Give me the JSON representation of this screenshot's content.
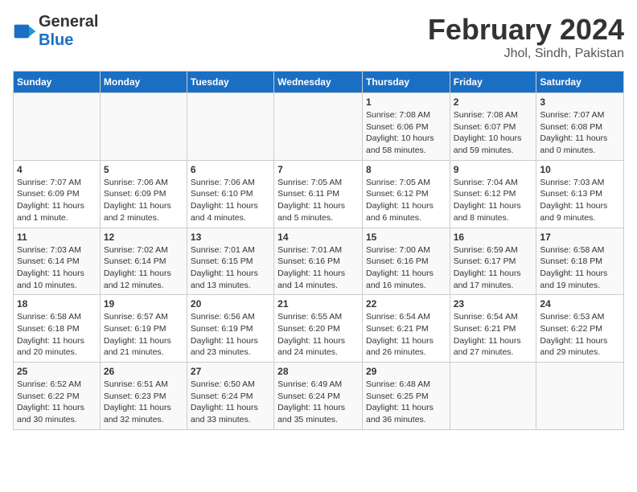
{
  "header": {
    "logo_line1": "General",
    "logo_line2": "Blue",
    "title": "February 2024",
    "subtitle": "Jhol, Sindh, Pakistan"
  },
  "calendar": {
    "days_of_week": [
      "Sunday",
      "Monday",
      "Tuesday",
      "Wednesday",
      "Thursday",
      "Friday",
      "Saturday"
    ],
    "weeks": [
      [
        {
          "day": "",
          "info": ""
        },
        {
          "day": "",
          "info": ""
        },
        {
          "day": "",
          "info": ""
        },
        {
          "day": "",
          "info": ""
        },
        {
          "day": "1",
          "info": "Sunrise: 7:08 AM\nSunset: 6:06 PM\nDaylight: 10 hours and 58 minutes."
        },
        {
          "day": "2",
          "info": "Sunrise: 7:08 AM\nSunset: 6:07 PM\nDaylight: 10 hours and 59 minutes."
        },
        {
          "day": "3",
          "info": "Sunrise: 7:07 AM\nSunset: 6:08 PM\nDaylight: 11 hours and 0 minutes."
        }
      ],
      [
        {
          "day": "4",
          "info": "Sunrise: 7:07 AM\nSunset: 6:09 PM\nDaylight: 11 hours and 1 minute."
        },
        {
          "day": "5",
          "info": "Sunrise: 7:06 AM\nSunset: 6:09 PM\nDaylight: 11 hours and 2 minutes."
        },
        {
          "day": "6",
          "info": "Sunrise: 7:06 AM\nSunset: 6:10 PM\nDaylight: 11 hours and 4 minutes."
        },
        {
          "day": "7",
          "info": "Sunrise: 7:05 AM\nSunset: 6:11 PM\nDaylight: 11 hours and 5 minutes."
        },
        {
          "day": "8",
          "info": "Sunrise: 7:05 AM\nSunset: 6:12 PM\nDaylight: 11 hours and 6 minutes."
        },
        {
          "day": "9",
          "info": "Sunrise: 7:04 AM\nSunset: 6:12 PM\nDaylight: 11 hours and 8 minutes."
        },
        {
          "day": "10",
          "info": "Sunrise: 7:03 AM\nSunset: 6:13 PM\nDaylight: 11 hours and 9 minutes."
        }
      ],
      [
        {
          "day": "11",
          "info": "Sunrise: 7:03 AM\nSunset: 6:14 PM\nDaylight: 11 hours and 10 minutes."
        },
        {
          "day": "12",
          "info": "Sunrise: 7:02 AM\nSunset: 6:14 PM\nDaylight: 11 hours and 12 minutes."
        },
        {
          "day": "13",
          "info": "Sunrise: 7:01 AM\nSunset: 6:15 PM\nDaylight: 11 hours and 13 minutes."
        },
        {
          "day": "14",
          "info": "Sunrise: 7:01 AM\nSunset: 6:16 PM\nDaylight: 11 hours and 14 minutes."
        },
        {
          "day": "15",
          "info": "Sunrise: 7:00 AM\nSunset: 6:16 PM\nDaylight: 11 hours and 16 minutes."
        },
        {
          "day": "16",
          "info": "Sunrise: 6:59 AM\nSunset: 6:17 PM\nDaylight: 11 hours and 17 minutes."
        },
        {
          "day": "17",
          "info": "Sunrise: 6:58 AM\nSunset: 6:18 PM\nDaylight: 11 hours and 19 minutes."
        }
      ],
      [
        {
          "day": "18",
          "info": "Sunrise: 6:58 AM\nSunset: 6:18 PM\nDaylight: 11 hours and 20 minutes."
        },
        {
          "day": "19",
          "info": "Sunrise: 6:57 AM\nSunset: 6:19 PM\nDaylight: 11 hours and 21 minutes."
        },
        {
          "day": "20",
          "info": "Sunrise: 6:56 AM\nSunset: 6:19 PM\nDaylight: 11 hours and 23 minutes."
        },
        {
          "day": "21",
          "info": "Sunrise: 6:55 AM\nSunset: 6:20 PM\nDaylight: 11 hours and 24 minutes."
        },
        {
          "day": "22",
          "info": "Sunrise: 6:54 AM\nSunset: 6:21 PM\nDaylight: 11 hours and 26 minutes."
        },
        {
          "day": "23",
          "info": "Sunrise: 6:54 AM\nSunset: 6:21 PM\nDaylight: 11 hours and 27 minutes."
        },
        {
          "day": "24",
          "info": "Sunrise: 6:53 AM\nSunset: 6:22 PM\nDaylight: 11 hours and 29 minutes."
        }
      ],
      [
        {
          "day": "25",
          "info": "Sunrise: 6:52 AM\nSunset: 6:22 PM\nDaylight: 11 hours and 30 minutes."
        },
        {
          "day": "26",
          "info": "Sunrise: 6:51 AM\nSunset: 6:23 PM\nDaylight: 11 hours and 32 minutes."
        },
        {
          "day": "27",
          "info": "Sunrise: 6:50 AM\nSunset: 6:24 PM\nDaylight: 11 hours and 33 minutes."
        },
        {
          "day": "28",
          "info": "Sunrise: 6:49 AM\nSunset: 6:24 PM\nDaylight: 11 hours and 35 minutes."
        },
        {
          "day": "29",
          "info": "Sunrise: 6:48 AM\nSunset: 6:25 PM\nDaylight: 11 hours and 36 minutes."
        },
        {
          "day": "",
          "info": ""
        },
        {
          "day": "",
          "info": ""
        }
      ]
    ]
  }
}
